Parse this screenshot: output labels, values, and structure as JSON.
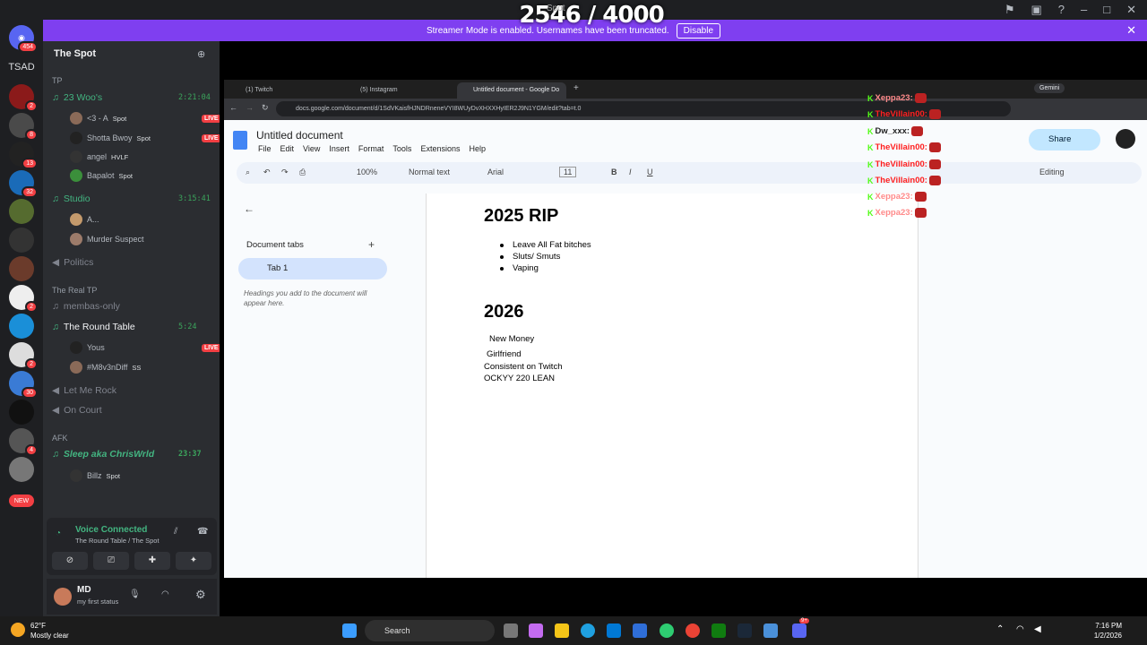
{
  "overlay": {
    "counter": "2546 / 4000",
    "counter_label": "Spot"
  },
  "banner": {
    "text": "Streamer Mode is enabled. Usernames have been truncated.",
    "button": "Disable"
  },
  "rail": {
    "home_badge": "454",
    "tsad_label": "TSAD",
    "new_label": "NEW",
    "badges": [
      "2",
      "8",
      "13",
      "32",
      "2",
      "2",
      "30",
      "5",
      "4"
    ]
  },
  "discord": {
    "server_name": "The Spot",
    "categories": {
      "tp": "TP",
      "real_tp": "The Real TP",
      "afk": "AFK"
    },
    "channels": {
      "woos": {
        "name": "23 Woo's",
        "time": "2:21:04"
      },
      "studio": {
        "name": "Studio",
        "time": "3:15:41"
      },
      "politics": "Politics",
      "membas": "membas-only",
      "round_table": {
        "name": "The Round Table",
        "time": "5:24"
      },
      "let_me_rock": "Let Me Rock",
      "on_court": "On Court",
      "sleep": {
        "name": "Sleep aka ChrisWrld",
        "time": "23:37"
      }
    },
    "members": {
      "m1": "<3 - A",
      "m1_tag": "Spot",
      "m2": "Shotta Bwoy",
      "m2_tag": "Spot",
      "m3": "angel",
      "m3_tag": "HVLF",
      "m4": "Bapalot",
      "m4_tag": "Spot",
      "m5": "A...",
      "m6": "Murder Suspect",
      "m7": "Yous",
      "m8": "#M8v3nDiff",
      "m8_tag": "SS",
      "m9": "Billz",
      "m9_tag": "Spot"
    },
    "live_label": "LIVE",
    "voice": {
      "status": "Voice Connected",
      "location": "The Round Table / The Spot"
    },
    "user": {
      "name": "MD",
      "status": "my first status"
    }
  },
  "chrome": {
    "tabs": [
      "(1) Twitch",
      "(5) Instagram",
      "Untitled document - Google Do"
    ],
    "gemini": "Gemini",
    "url": "docs.google.com/document/d/1SdVKaisfHJNDRneneVYI8WUyDvXHXXHyIER2J9N1YGM/edit?tab=t.0"
  },
  "docs": {
    "title": "Untitled document",
    "menus": [
      "File",
      "Edit",
      "View",
      "Insert",
      "Format",
      "Tools",
      "Extensions",
      "Help"
    ],
    "zoom": "100%",
    "style": "Normal text",
    "font": "Arial",
    "size": "11",
    "share": "Share",
    "mode": "Editing",
    "panel": {
      "title": "Document tabs",
      "tab": "Tab 1",
      "hint": "Headings you add to the document will appear here."
    },
    "body": {
      "h1": "2025 RIP",
      "bullets": [
        "Leave All Fat bitches",
        "Sluts/ Smuts",
        "Vaping"
      ],
      "h2": "2026",
      "lines": [
        "New Money",
        "Girlfriend",
        "Consistent on Twitch",
        "OCKYY 220 LEAN"
      ]
    }
  },
  "chat": [
    {
      "user": "Xeppa23:",
      "color": "#ff8a8a"
    },
    {
      "user": "TheVillain00:",
      "color": "#ff2020"
    },
    {
      "user": "Dw_xxx:",
      "color": "#ffffff"
    },
    {
      "user": "TheVillain00:",
      "color": "#ff2020"
    },
    {
      "user": "TheVillain00:",
      "color": "#ff2020"
    },
    {
      "user": "TheVillain00:",
      "color": "#ff2020"
    },
    {
      "user": "Xeppa23:",
      "color": "#ff8a8a"
    },
    {
      "user": "Xeppa23:",
      "color": "#ff8a8a"
    }
  ],
  "taskbar": {
    "temp": "62°F",
    "weather": "Mostly clear",
    "search": "Search",
    "time": "7:16 PM",
    "date": "1/2/2026",
    "discord_badge": "9+"
  }
}
